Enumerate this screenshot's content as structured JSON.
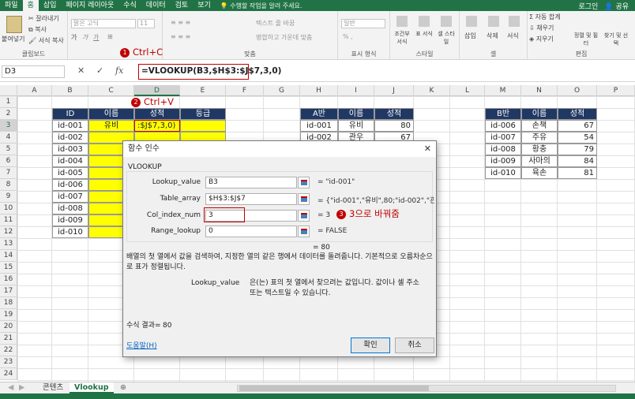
{
  "ribbon": {
    "tabs": [
      "파일",
      "홈",
      "삽입",
      "페이지 레이아웃",
      "수식",
      "데이터",
      "검토",
      "보기"
    ],
    "active_tab": "홈",
    "tell_me": "수행할 작업을 알려 주세요.",
    "login": "로그인",
    "share": "공유",
    "clipboard": {
      "paste": "붙여넣기",
      "cut": "잘라내기",
      "copy": "복사",
      "format_painter": "서식 복사",
      "label": "클립보드"
    },
    "font": {
      "name": "맑은 고딕",
      "size": "11"
    },
    "alignment": {
      "wrap": "텍스트 줄 바꿈",
      "merge": "병합하고 가운데 맞춤",
      "label": "맞춤"
    },
    "number": {
      "format": "일반",
      "label": "표시 형식"
    },
    "styles": {
      "conditional": "조건부 서식",
      "table": "표 서식",
      "cell_style": "셀 스타일",
      "label": "스타일"
    },
    "cells": {
      "insert": "삽입",
      "delete": "삭제",
      "format": "서식",
      "label": "셀"
    },
    "editing": {
      "autosum": "자동 합계",
      "fill": "채우기",
      "clear": "지우기",
      "sort": "정렬 및 필터",
      "find": "찾기 및 선택",
      "label": "편집"
    }
  },
  "formula_bar": {
    "name_box": "D3",
    "cancel": "✕",
    "enter": "✓",
    "fx": "fx",
    "formula": "=VLOOKUP(B3,$H$3:$J$7,3,0)"
  },
  "callouts": {
    "c1": {
      "num": "1",
      "text": "Ctrl+C"
    },
    "c2": {
      "num": "2",
      "text": "Ctrl+V"
    },
    "c3": {
      "num": "3",
      "text": "3으로 바꿔줌"
    }
  },
  "columns": [
    "A",
    "B",
    "C",
    "D",
    "E",
    "F",
    "G",
    "H",
    "I",
    "J",
    "K",
    "L",
    "M",
    "N",
    "O",
    "P"
  ],
  "rows": [
    "1",
    "2",
    "3",
    "4",
    "5",
    "6",
    "7",
    "8",
    "9",
    "10",
    "11",
    "12",
    "13",
    "14",
    "15",
    "16",
    "17",
    "18",
    "19",
    "20",
    "21",
    "22",
    "23",
    "24"
  ],
  "table_main": {
    "headers": [
      "ID",
      "이름",
      "성적",
      "등급"
    ],
    "rows": [
      [
        "id-001",
        "유비",
        ":$J$7,3,0)",
        ""
      ],
      [
        "id-002",
        "",
        "",
        ""
      ],
      [
        "id-003",
        "",
        "",
        ""
      ],
      [
        "id-004",
        "",
        "",
        ""
      ],
      [
        "id-005",
        "",
        "",
        ""
      ],
      [
        "id-006",
        "",
        "",
        ""
      ],
      [
        "id-007",
        "",
        "",
        ""
      ],
      [
        "id-008",
        "",
        "",
        ""
      ],
      [
        "id-009",
        "",
        "",
        ""
      ],
      [
        "id-010",
        "",
        "",
        ""
      ]
    ]
  },
  "table_a": {
    "headers": [
      "A반",
      "이름",
      "성적"
    ],
    "rows": [
      [
        "id-001",
        "유비",
        "80"
      ],
      [
        "id-002",
        "관우",
        "67"
      ]
    ]
  },
  "table_b": {
    "headers": [
      "B반",
      "이름",
      "성적"
    ],
    "rows": [
      [
        "id-006",
        "손책",
        "67"
      ],
      [
        "id-007",
        "주유",
        "54"
      ],
      [
        "id-008",
        "황충",
        "79"
      ],
      [
        "id-009",
        "사마의",
        "84"
      ],
      [
        "id-010",
        "육손",
        "81"
      ]
    ]
  },
  "dialog": {
    "title": "함수 인수",
    "close": "✕",
    "function_name": "VLOOKUP",
    "args": [
      {
        "label": "Lookup_value",
        "value": "B3",
        "result": "= \"id-001\""
      },
      {
        "label": "Table_array",
        "value": "$H$3:$J$7",
        "result": "= {\"id-001\",\"유비\",80;\"id-002\",\"관우\",..."
      },
      {
        "label": "Col_index_num",
        "value": "3",
        "result": "= 3"
      },
      {
        "label": "Range_lookup",
        "value": "0",
        "result": "= FALSE"
      }
    ],
    "total_result": "= 80",
    "description": "배열의 첫 열에서 값을 검색하여, 지정한 열의 같은 행에서 데이터를 돌려줍니다. 기본적으로 오름차순으로 표가 정렬됩니다.",
    "arg_help_name": "Lookup_value",
    "arg_help_text": "은(는) 표의 첫 열에서 찾으려는 값입니다. 값이나 셀 주소 또는 텍스트일 수 있습니다.",
    "formula_result_label": "수식 결과=",
    "formula_result_value": "80",
    "help_link": "도움말(H)",
    "ok": "확인",
    "cancel": "취소"
  },
  "sheet_tabs": [
    "콘텐츠",
    "Vlookup"
  ],
  "active_sheet": "Vlookup",
  "colors": {
    "excel_green": "#217346",
    "header_navy": "#203864",
    "highlight_yellow": "#ffff00",
    "callout_red": "#c00000"
  }
}
